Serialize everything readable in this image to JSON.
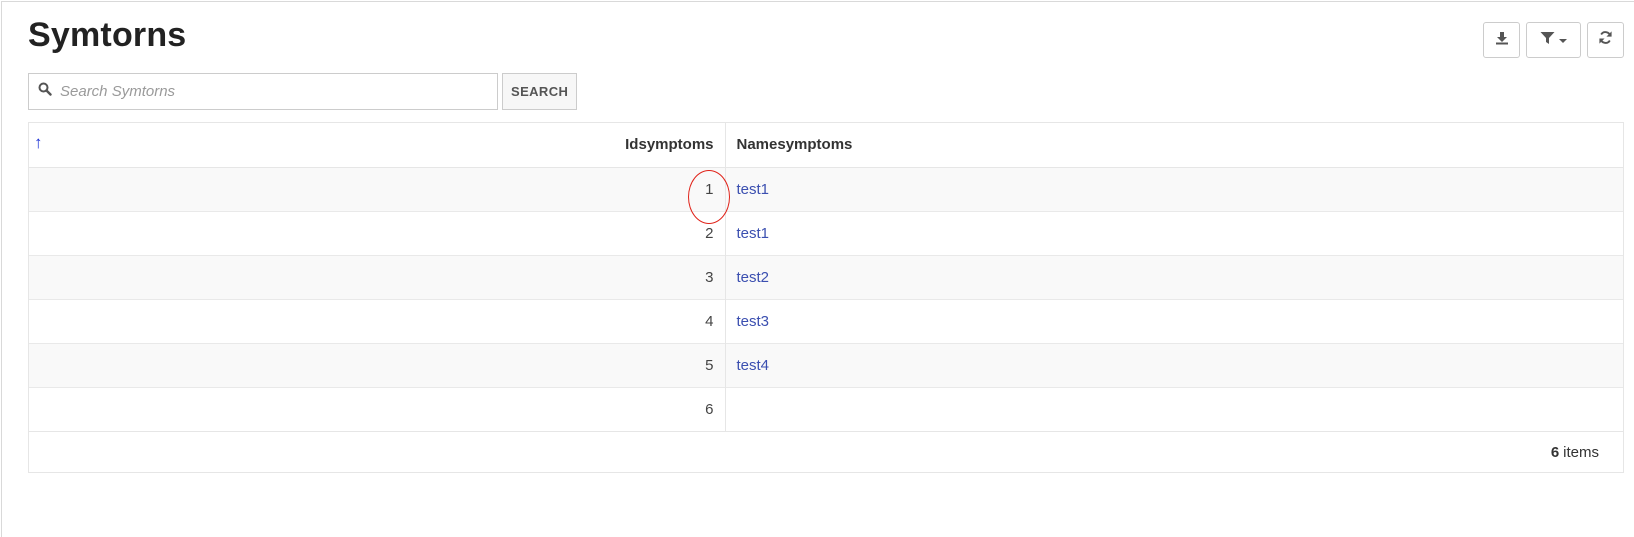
{
  "page": {
    "title": "Symtorns"
  },
  "toolbar": {
    "download_icon": "download-icon",
    "filter_icon": "filter-icon",
    "refresh_icon": "refresh-icon"
  },
  "search": {
    "placeholder": "Search Symtorns",
    "value": "",
    "button_label": "SEARCH"
  },
  "table": {
    "columns": {
      "id": "Idsymptoms",
      "name": "Namesymptoms"
    },
    "sort": "ascending",
    "rows": [
      {
        "id": "1",
        "name": "test1"
      },
      {
        "id": "2",
        "name": "test1"
      },
      {
        "id": "3",
        "name": "test2"
      },
      {
        "id": "4",
        "name": "test3"
      },
      {
        "id": "5",
        "name": "test4"
      },
      {
        "id": "6",
        "name": ""
      }
    ]
  },
  "footer": {
    "count": "6",
    "items_label": "items"
  },
  "colors": {
    "accent": "#1a2fd4",
    "link": "#3b4fb0",
    "annotation": "#e0231a"
  }
}
